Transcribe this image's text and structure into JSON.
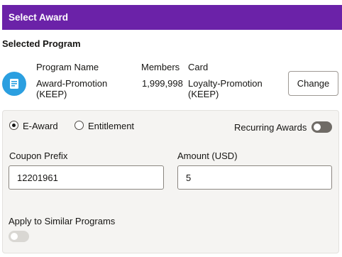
{
  "header": {
    "title": "Select Award"
  },
  "selected_program": {
    "section_title": "Selected Program",
    "icon": "program-icon",
    "columns": {
      "program_name": "Program Name",
      "members": "Members",
      "card": "Card"
    },
    "program_name": "Award-Promotion (KEEP)",
    "members": "1,999,998",
    "card": "Loyalty-Promotion (KEEP)",
    "change_label": "Change"
  },
  "award_type": {
    "options": [
      {
        "label": "E-Award",
        "selected": true
      },
      {
        "label": "Entitlement",
        "selected": false
      }
    ]
  },
  "recurring_awards": {
    "label": "Recurring Awards",
    "on": false
  },
  "coupon_prefix": {
    "label": "Coupon Prefix",
    "value": "12201961"
  },
  "amount": {
    "label": "Amount (USD)",
    "value": "5"
  },
  "apply_similar": {
    "label": "Apply to Similar Programs",
    "on": false
  },
  "colors": {
    "header_bg": "#6b22a8",
    "icon_bg": "#2b9fe0",
    "panel_bg": "#f5f4f2"
  }
}
